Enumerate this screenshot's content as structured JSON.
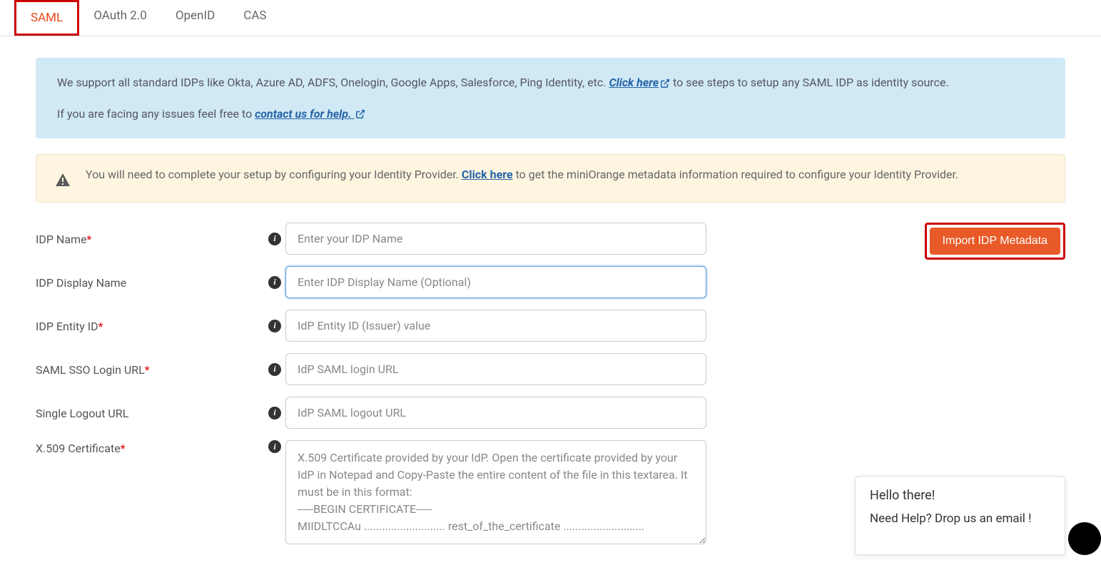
{
  "tabs": [
    {
      "label": "SAML",
      "active": true
    },
    {
      "label": "OAuth 2.0",
      "active": false
    },
    {
      "label": "OpenID",
      "active": false
    },
    {
      "label": "CAS",
      "active": false
    }
  ],
  "info_banner": {
    "line1_pre": "We support all standard IDPs like Okta, Azure AD, ADFS, Onelogin, Google Apps, Salesforce, Ping Identity, etc. ",
    "link1": "Click here",
    "line1_post": " to see steps to setup any SAML IDP as identity source.",
    "line2_pre": "If you are facing any issues feel free to ",
    "link2": "contact us for help."
  },
  "warn_banner": {
    "pre": "You will need to complete your setup by configuring your Identity Provider. ",
    "link": "Click here",
    "post": " to get the miniOrange metadata information required to configure your Identity Provider."
  },
  "form": {
    "idp_name": {
      "label": "IDP Name",
      "required": true,
      "placeholder": "Enter your IDP Name"
    },
    "idp_display_name": {
      "label": "IDP Display Name",
      "required": false,
      "placeholder": "Enter IDP Display Name (Optional)"
    },
    "idp_entity_id": {
      "label": "IDP Entity ID",
      "required": true,
      "placeholder": "IdP Entity ID (Issuer) value"
    },
    "saml_sso_login_url": {
      "label": "SAML SSO Login URL",
      "required": true,
      "placeholder": "IdP SAML login URL"
    },
    "single_logout_url": {
      "label": "Single Logout URL",
      "required": false,
      "placeholder": "IdP SAML logout URL"
    },
    "x509_cert": {
      "label": "X.509 Certificate",
      "required": true,
      "placeholder": "X.509 Certificate provided by your IdP. Open the certificate provided by your IdP in Notepad and Copy-Paste the entire content of the file in this textarea. It must be in this format:\n-----BEGIN CERTIFICATE-----\nMIIDLTCCAu ........................... rest_of_the_certificate ..........................."
    }
  },
  "import_button": "Import IDP Metadata",
  "chat": {
    "greeting": "Hello there!",
    "prompt": "Need Help? Drop us an email !"
  }
}
